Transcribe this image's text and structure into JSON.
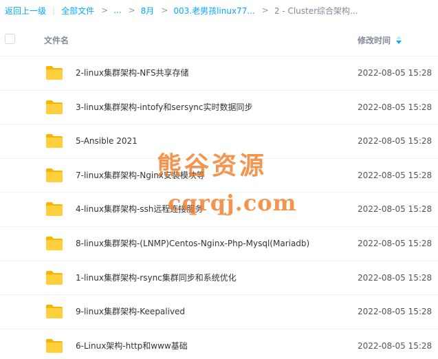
{
  "breadcrumb": {
    "back": "返回上一级",
    "root": "全部文件",
    "ellipsis": "...",
    "month": "8月",
    "folder": "003.老男孩linux77...",
    "current": "2 - Cluster综合架构...",
    "separator": ">",
    "pipe": "|"
  },
  "header": {
    "name_label": "文件名",
    "time_label": "修改时间",
    "sort_icon": "sort-desc-icon"
  },
  "files": [
    {
      "name": "2-linux集群架构-NFS共享存储",
      "time": "2022-08-05 15:28"
    },
    {
      "name": "3-linux集群架构-intofy和sersync实时数据同步",
      "time": "2022-08-05 15:28"
    },
    {
      "name": "5-Ansible 2021",
      "time": "2022-08-05 15:28"
    },
    {
      "name": "7-linux集群架构-Nginx安装模块等",
      "time": "2022-08-05 15:28"
    },
    {
      "name": "4-linux集群架构-ssh远程连接服务",
      "time": "2022-08-05 15:28"
    },
    {
      "name": "8-linux集群架构-(LNMP)Centos-Nginx-Php-Mysql(Mariadb)",
      "time": "2022-08-05 15:28"
    },
    {
      "name": "1-linux集群架构-rsync集群同步和系统优化",
      "time": "2022-08-05 15:28"
    },
    {
      "name": "9-linux集群架构-Keepalived",
      "time": "2022-08-05 15:28"
    },
    {
      "name": "6-Linux架构-http和www基础",
      "time": "2022-08-05 15:28"
    }
  ],
  "watermark": {
    "title": "熊谷资源",
    "url": "cqrqj.com"
  },
  "colors": {
    "link": "#06a7ff",
    "folder": "#ffc107",
    "watermark": "#f07d28"
  }
}
